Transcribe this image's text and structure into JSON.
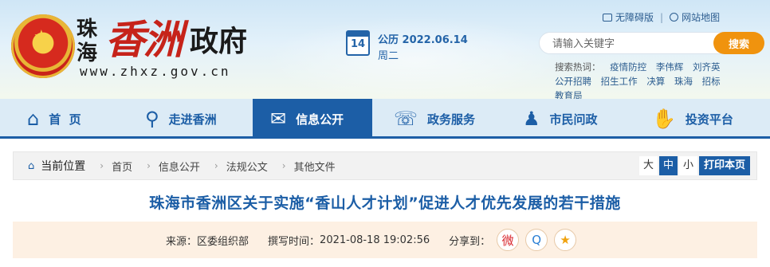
{
  "header": {
    "logo": {
      "city": "珠海",
      "district": "香洲",
      "gov": "政府",
      "url": "www.zhxz.gov.cn"
    },
    "calendar": {
      "day": "14",
      "date_line": "公历 2022.06.14",
      "weekday": "周二"
    },
    "toplinks": {
      "accessible": "无障碍版",
      "sitemap": "网站地图",
      "separator": "|"
    },
    "search": {
      "placeholder": "请输入关键字",
      "button": "搜索"
    },
    "hot": {
      "label": "搜索热词：",
      "items": [
        "疫情防控",
        "李伟辉",
        "刘齐英",
        "公开招聘",
        "招生工作",
        "决算",
        "珠海",
        "招标",
        "教育局"
      ]
    }
  },
  "nav": {
    "items": [
      {
        "label": "首  页",
        "icon": "home-icon",
        "glyph": "⌂"
      },
      {
        "label": "走进香洲",
        "icon": "location-pin-icon",
        "glyph": "⚲"
      },
      {
        "label": "信息公开",
        "icon": "mail-icon",
        "glyph": "✉"
      },
      {
        "label": "政务服务",
        "icon": "service-icon",
        "glyph": "☏"
      },
      {
        "label": "市民问政",
        "icon": "citizen-icon",
        "glyph": "♟"
      },
      {
        "label": "投资平台",
        "icon": "handshake-icon",
        "glyph": "✋"
      }
    ],
    "active_index": 2
  },
  "breadcrumb": {
    "current_label": "当前位置",
    "arrow": "›",
    "items": [
      "首页",
      "信息公开",
      "法规公文",
      "其他文件"
    ]
  },
  "font_size": {
    "large": "大",
    "medium": "中",
    "small": "小",
    "selected": "中",
    "print": "打印本页"
  },
  "article": {
    "title": "珠海市香洲区关于实施“香山人才计划”促进人才优先发展的若干措施",
    "source_label": "来源：",
    "source": "区委组织部",
    "time_label": "撰写时间：",
    "time": "2021-08-18 19:02:56",
    "share_label": "分享到：",
    "share": {
      "weibo": "微",
      "qq": "Q",
      "fav": "★"
    }
  },
  "colors": {
    "primary": "#1c5ea6",
    "accent": "#f0930e",
    "logo_red": "#c6231a",
    "meta_bg": "#fdf0e3"
  }
}
